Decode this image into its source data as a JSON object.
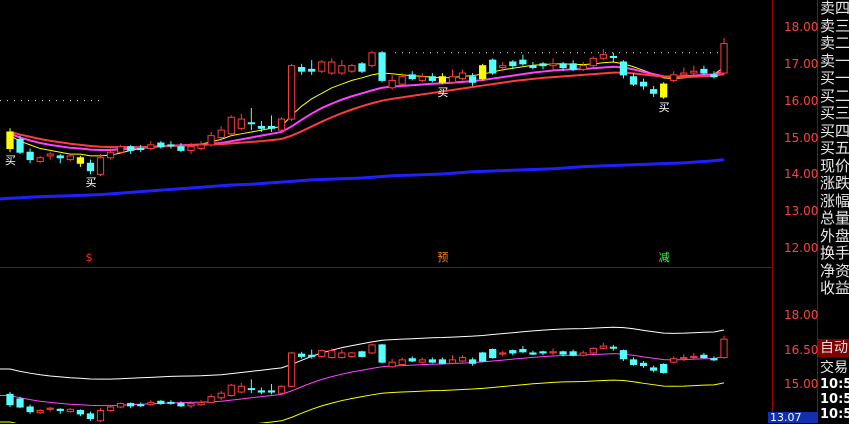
{
  "chart_data": [
    {
      "type": "candlestick",
      "ylim": [
        11.5,
        18.5
      ],
      "y_ticks": [
        "18.00",
        "17.00",
        "16.00",
        "15.00",
        "14.00",
        "13.00",
        "12.00"
      ],
      "candles": [
        {
          "o": 15.15,
          "c": 14.7,
          "h": 15.25,
          "l": 14.6,
          "color": "yellow"
        },
        {
          "o": 14.95,
          "c": 14.6,
          "h": 15.05,
          "l": 14.55,
          "color": "cyan"
        },
        {
          "o": 14.6,
          "c": 14.4,
          "h": 14.7,
          "l": 14.3,
          "color": "cyan"
        },
        {
          "o": 14.35,
          "c": 14.45,
          "h": 14.5,
          "l": 14.3,
          "color": "red"
        },
        {
          "o": 14.5,
          "c": 14.55,
          "h": 14.6,
          "l": 14.4,
          "color": "red"
        },
        {
          "o": 14.5,
          "c": 14.45,
          "h": 14.55,
          "l": 14.3,
          "color": "cyan"
        },
        {
          "o": 14.4,
          "c": 14.5,
          "h": 14.55,
          "l": 14.35,
          "color": "red"
        },
        {
          "o": 14.45,
          "c": 14.3,
          "h": 14.5,
          "l": 14.2,
          "color": "yellow"
        },
        {
          "o": 14.3,
          "c": 14.1,
          "h": 14.4,
          "l": 14.0,
          "color": "cyan"
        },
        {
          "o": 14.0,
          "c": 14.45,
          "h": 14.55,
          "l": 13.95,
          "color": "red"
        },
        {
          "o": 14.45,
          "c": 14.6,
          "h": 14.7,
          "l": 14.4,
          "color": "red"
        },
        {
          "o": 14.6,
          "c": 14.75,
          "h": 14.8,
          "l": 14.55,
          "color": "red"
        },
        {
          "o": 14.75,
          "c": 14.65,
          "h": 14.8,
          "l": 14.55,
          "color": "cyan"
        },
        {
          "o": 14.7,
          "c": 14.7,
          "h": 14.8,
          "l": 14.6,
          "color": "cyan"
        },
        {
          "o": 14.7,
          "c": 14.8,
          "h": 14.9,
          "l": 14.65,
          "color": "red"
        },
        {
          "o": 14.85,
          "c": 14.75,
          "h": 14.9,
          "l": 14.7,
          "color": "cyan"
        },
        {
          "o": 14.8,
          "c": 14.8,
          "h": 14.9,
          "l": 14.7,
          "color": "cyan"
        },
        {
          "o": 14.75,
          "c": 14.65,
          "h": 14.85,
          "l": 14.6,
          "color": "cyan"
        },
        {
          "o": 14.65,
          "c": 14.75,
          "h": 14.85,
          "l": 14.55,
          "color": "red"
        },
        {
          "o": 14.7,
          "c": 14.8,
          "h": 14.9,
          "l": 14.65,
          "color": "red"
        },
        {
          "o": 14.8,
          "c": 15.05,
          "h": 15.15,
          "l": 14.75,
          "color": "red"
        },
        {
          "o": 15.0,
          "c": 15.2,
          "h": 15.3,
          "l": 14.9,
          "color": "red"
        },
        {
          "o": 15.1,
          "c": 15.55,
          "h": 15.6,
          "l": 15.05,
          "color": "red"
        },
        {
          "o": 15.5,
          "c": 15.25,
          "h": 15.65,
          "l": 15.2,
          "color": "red"
        },
        {
          "o": 15.4,
          "c": 15.4,
          "h": 15.8,
          "l": 15.2,
          "color": "cyan"
        },
        {
          "o": 15.3,
          "c": 15.25,
          "h": 15.45,
          "l": 15.15,
          "color": "cyan"
        },
        {
          "o": 15.25,
          "c": 15.3,
          "h": 15.6,
          "l": 15.15,
          "color": "cyan"
        },
        {
          "o": 15.2,
          "c": 15.5,
          "h": 15.55,
          "l": 15.15,
          "color": "red"
        },
        {
          "o": 15.5,
          "c": 16.95,
          "h": 17.0,
          "l": 15.45,
          "color": "red"
        },
        {
          "o": 16.9,
          "c": 16.8,
          "h": 17.0,
          "l": 16.7,
          "color": "cyan"
        },
        {
          "o": 16.8,
          "c": 16.85,
          "h": 17.1,
          "l": 16.7,
          "color": "cyan"
        },
        {
          "o": 16.8,
          "c": 17.05,
          "h": 17.1,
          "l": 16.75,
          "color": "red"
        },
        {
          "o": 17.05,
          "c": 16.75,
          "h": 17.15,
          "l": 16.7,
          "color": "red"
        },
        {
          "o": 16.75,
          "c": 16.95,
          "h": 17.1,
          "l": 16.7,
          "color": "red"
        },
        {
          "o": 16.95,
          "c": 16.8,
          "h": 17.0,
          "l": 16.75,
          "color": "red"
        },
        {
          "o": 16.8,
          "c": 17.0,
          "h": 17.05,
          "l": 16.75,
          "color": "cyan"
        },
        {
          "o": 16.95,
          "c": 17.3,
          "h": 17.35,
          "l": 16.9,
          "color": "red"
        },
        {
          "o": 17.3,
          "c": 16.55,
          "h": 17.35,
          "l": 16.5,
          "color": "cyan"
        },
        {
          "o": 16.55,
          "c": 16.35,
          "h": 16.7,
          "l": 16.3,
          "color": "red"
        },
        {
          "o": 16.45,
          "c": 16.65,
          "h": 16.75,
          "l": 16.4,
          "color": "red"
        },
        {
          "o": 16.6,
          "c": 16.7,
          "h": 16.8,
          "l": 16.55,
          "color": "cyan"
        },
        {
          "o": 16.65,
          "c": 16.55,
          "h": 16.75,
          "l": 16.5,
          "color": "red"
        },
        {
          "o": 16.55,
          "c": 16.65,
          "h": 16.75,
          "l": 16.5,
          "color": "cyan"
        },
        {
          "o": 16.65,
          "c": 16.5,
          "h": 16.75,
          "l": 16.45,
          "color": "yellow"
        },
        {
          "o": 16.5,
          "c": 16.65,
          "h": 16.85,
          "l": 16.45,
          "color": "red"
        },
        {
          "o": 16.6,
          "c": 16.75,
          "h": 16.85,
          "l": 16.55,
          "color": "red"
        },
        {
          "o": 16.65,
          "c": 16.5,
          "h": 16.75,
          "l": 16.4,
          "color": "cyan"
        },
        {
          "o": 16.6,
          "c": 16.95,
          "h": 17.0,
          "l": 16.55,
          "color": "yellow"
        },
        {
          "o": 16.75,
          "c": 17.1,
          "h": 17.15,
          "l": 16.7,
          "color": "cyan"
        },
        {
          "o": 16.9,
          "c": 16.95,
          "h": 17.05,
          "l": 16.8,
          "color": "red"
        },
        {
          "o": 16.95,
          "c": 17.05,
          "h": 17.1,
          "l": 16.85,
          "color": "cyan"
        },
        {
          "o": 17.1,
          "c": 17.0,
          "h": 17.25,
          "l": 16.95,
          "color": "cyan"
        },
        {
          "o": 16.95,
          "c": 16.9,
          "h": 17.05,
          "l": 16.85,
          "color": "cyan"
        },
        {
          "o": 16.95,
          "c": 17.0,
          "h": 17.05,
          "l": 16.85,
          "color": "cyan"
        },
        {
          "o": 17.0,
          "c": 16.95,
          "h": 17.15,
          "l": 16.85,
          "color": "red"
        },
        {
          "o": 16.9,
          "c": 17.0,
          "h": 17.05,
          "l": 16.8,
          "color": "cyan"
        },
        {
          "o": 17.0,
          "c": 16.85,
          "h": 17.1,
          "l": 16.8,
          "color": "cyan"
        },
        {
          "o": 16.85,
          "c": 16.95,
          "h": 17.05,
          "l": 16.8,
          "color": "red"
        },
        {
          "o": 16.95,
          "c": 17.15,
          "h": 17.2,
          "l": 16.9,
          "color": "red"
        },
        {
          "o": 17.15,
          "c": 17.25,
          "h": 17.4,
          "l": 17.1,
          "color": "red"
        },
        {
          "o": 17.2,
          "c": 17.2,
          "h": 17.3,
          "l": 17.05,
          "color": "cyan"
        },
        {
          "o": 17.05,
          "c": 16.7,
          "h": 17.1,
          "l": 16.6,
          "color": "cyan"
        },
        {
          "o": 16.65,
          "c": 16.45,
          "h": 16.75,
          "l": 16.4,
          "color": "cyan"
        },
        {
          "o": 16.5,
          "c": 16.4,
          "h": 16.6,
          "l": 16.3,
          "color": "cyan"
        },
        {
          "o": 16.3,
          "c": 16.2,
          "h": 16.4,
          "l": 16.1,
          "color": "cyan"
        },
        {
          "o": 16.45,
          "c": 16.1,
          "h": 16.5,
          "l": 16.05,
          "color": "yellow"
        },
        {
          "o": 16.55,
          "c": 16.7,
          "h": 16.8,
          "l": 16.5,
          "color": "red"
        },
        {
          "o": 16.7,
          "c": 16.75,
          "h": 16.9,
          "l": 16.6,
          "color": "red"
        },
        {
          "o": 16.75,
          "c": 16.8,
          "h": 16.95,
          "l": 16.7,
          "color": "red"
        },
        {
          "o": 16.85,
          "c": 16.75,
          "h": 16.95,
          "l": 16.7,
          "color": "cyan"
        },
        {
          "o": 16.65,
          "c": 16.7,
          "h": 16.8,
          "l": 16.6,
          "color": "cyan"
        },
        {
          "o": 16.75,
          "c": 17.55,
          "h": 17.7,
          "l": 16.7,
          "color": "red"
        }
      ],
      "ma_series": [
        {
          "color": "yellow",
          "values": [
            15.05,
            14.9,
            14.8,
            14.7,
            14.65,
            14.6,
            14.55,
            14.55,
            14.5,
            14.5,
            14.52,
            14.58,
            14.65,
            14.7,
            14.73,
            14.76,
            14.78,
            14.79,
            14.8,
            14.82,
            14.88,
            14.95,
            15.05,
            15.1,
            15.15,
            15.2,
            15.25,
            15.3,
            15.6,
            15.85,
            16.05,
            16.2,
            16.35,
            16.45,
            16.55,
            16.62,
            16.7,
            16.75,
            16.73,
            16.7,
            16.68,
            16.66,
            16.64,
            16.62,
            16.63,
            16.66,
            16.68,
            16.72,
            16.78,
            16.84,
            16.88,
            16.92,
            16.96,
            16.98,
            17.0,
            17.0,
            16.99,
            16.98,
            17.0,
            17.03,
            17.05,
            17.0,
            16.92,
            16.82,
            16.72,
            16.62,
            16.6,
            16.62,
            16.65,
            16.7,
            16.72,
            16.9
          ]
        },
        {
          "color": "magenta",
          "values": [
            15.1,
            15.0,
            14.92,
            14.85,
            14.8,
            14.76,
            14.72,
            14.7,
            14.67,
            14.66,
            14.66,
            14.68,
            14.7,
            14.72,
            14.74,
            14.76,
            14.78,
            14.79,
            14.8,
            14.81,
            14.83,
            14.85,
            14.9,
            14.95,
            15.0,
            15.05,
            15.1,
            15.15,
            15.3,
            15.48,
            15.65,
            15.8,
            15.92,
            16.03,
            16.12,
            16.2,
            16.28,
            16.35,
            16.38,
            16.4,
            16.42,
            16.44,
            16.46,
            16.47,
            16.49,
            16.51,
            16.53,
            16.56,
            16.6,
            16.64,
            16.68,
            16.72,
            16.76,
            16.79,
            16.82,
            16.84,
            16.85,
            16.86,
            16.88,
            16.9,
            16.92,
            16.9,
            16.85,
            16.78,
            16.72,
            16.66,
            16.65,
            16.66,
            16.68,
            16.7,
            16.71,
            16.8
          ]
        },
        {
          "color": "red",
          "values": [
            15.15,
            15.08,
            15.02,
            14.96,
            14.91,
            14.87,
            14.83,
            14.8,
            14.77,
            14.75,
            14.74,
            14.74,
            14.74,
            14.74,
            14.75,
            14.76,
            14.77,
            14.78,
            14.79,
            14.8,
            14.81,
            14.82,
            14.84,
            14.86,
            14.88,
            14.9,
            14.93,
            14.96,
            15.05,
            15.17,
            15.3,
            15.43,
            15.55,
            15.66,
            15.76,
            15.85,
            15.93,
            16.0,
            16.05,
            16.09,
            16.13,
            16.17,
            16.21,
            16.25,
            16.29,
            16.33,
            16.37,
            16.41,
            16.45,
            16.49,
            16.53,
            16.56,
            16.59,
            16.62,
            16.64,
            16.66,
            16.68,
            16.7,
            16.72,
            16.74,
            16.76,
            16.76,
            16.74,
            16.71,
            16.68,
            16.65,
            16.64,
            16.64,
            16.65,
            16.66,
            16.67,
            16.72
          ]
        },
        {
          "color": "blue",
          "values": [
            13.35,
            13.36,
            13.38,
            13.39,
            13.4,
            13.41,
            13.42,
            13.43,
            13.44,
            13.45,
            13.47,
            13.49,
            13.51,
            13.53,
            13.55,
            13.57,
            13.59,
            13.61,
            13.63,
            13.65,
            13.67,
            13.69,
            13.71,
            13.72,
            13.73,
            13.75,
            13.77,
            13.79,
            13.81,
            13.83,
            13.85,
            13.86,
            13.87,
            13.88,
            13.89,
            13.9,
            13.92,
            13.94,
            13.96,
            13.97,
            13.98,
            13.99,
            14.0,
            14.01,
            14.03,
            14.05,
            14.07,
            14.08,
            14.09,
            14.1,
            14.11,
            14.12,
            14.13,
            14.14,
            14.15,
            14.17,
            14.19,
            14.21,
            14.22,
            14.23,
            14.24,
            14.25,
            14.26,
            14.27,
            14.28,
            14.29,
            14.3,
            14.31,
            14.33,
            14.35,
            14.37,
            14.4
          ]
        }
      ],
      "dotted_levels": [
        17.3,
        16.0
      ],
      "buy_signals": [
        {
          "index": 0,
          "label": "买"
        },
        {
          "index": 8,
          "label": "买"
        },
        {
          "index": 43,
          "label": "买"
        },
        {
          "index": 65,
          "label": "买"
        }
      ],
      "markers": [
        {
          "index": 8,
          "label": "$",
          "color": "#ff3030"
        },
        {
          "index": 43,
          "label": "预",
          "color": "#ff8020"
        },
        {
          "index": 65,
          "label": "减",
          "color": "#40ff40"
        }
      ]
    },
    {
      "type": "candlestick-bands",
      "ylim": [
        14.3,
        19.0
      ],
      "y_ticks": [
        "18.00",
        "16.50",
        "15.00"
      ],
      "bands": [
        {
          "color": "white",
          "offset": 1.15
        },
        {
          "color": "magenta",
          "offset": 0
        },
        {
          "color": "yellow",
          "offset": -1.15
        }
      ]
    }
  ],
  "side_panel": {
    "labels": [
      "卖四",
      "卖三",
      "卖二",
      "卖一",
      "买一",
      "买二",
      "买三",
      "买四",
      "买五",
      "现价",
      "涨跌",
      "涨幅",
      "总量",
      "外盘",
      "换手",
      "净资",
      "收益"
    ],
    "auto_label": "自动",
    "trade_label": "交易",
    "times": [
      "10:5",
      "10:5",
      "10:5"
    ],
    "price_box": "13.07"
  }
}
